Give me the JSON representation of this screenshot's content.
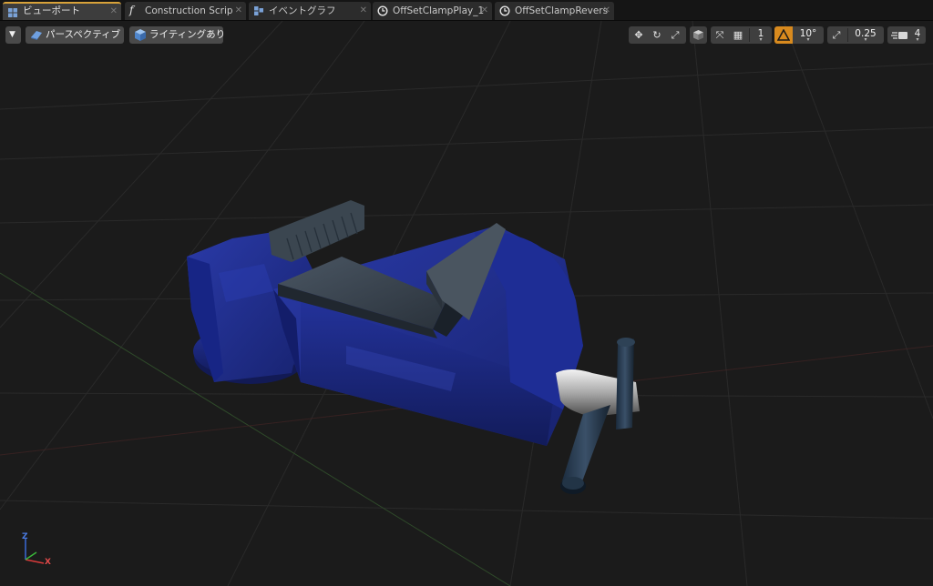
{
  "tabs": [
    {
      "label": "ビューポート",
      "icon": "viewport-grid-icon",
      "active": true
    },
    {
      "label": "Construction Scrip",
      "icon": "function-icon"
    },
    {
      "label": "イベントグラフ",
      "icon": "event-graph-icon"
    },
    {
      "label": "OffSetClampPlay_1",
      "icon": "timeline-clock-icon"
    },
    {
      "label": "OffSetClampRevers",
      "icon": "timeline-clock-icon"
    }
  ],
  "viewport": {
    "options_menu": "dropdown-arrow-icon",
    "view_mode_label": "パースペクティブ",
    "lighting_mode_label": "ライティングあり",
    "toolbar": {
      "rotation_snap": "10°",
      "scale_snap": "0.25",
      "grid_snap": "1",
      "camera_speed": "4"
    },
    "axis": {
      "x": "X",
      "y": "Y",
      "z": "Z"
    },
    "colors": {
      "accent": "#d8a23a",
      "snap_warning": "#d88a1e",
      "vice_body": "#1f2f8e"
    }
  }
}
